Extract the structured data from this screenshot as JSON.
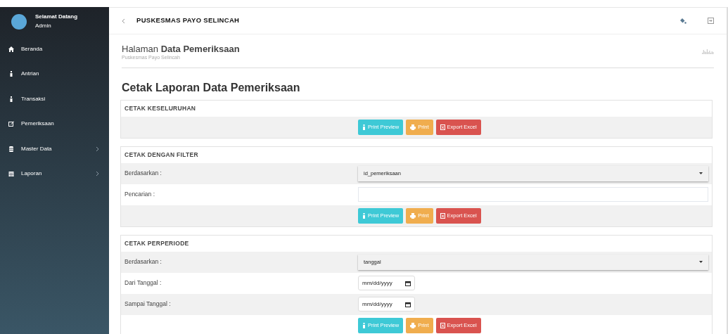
{
  "sidebar": {
    "greeting": "Selamat Datang",
    "user": "Admin",
    "items": [
      {
        "label": "Beranda",
        "kind": "home",
        "has_children": false
      },
      {
        "label": "Antrian",
        "kind": "info",
        "has_children": false
      },
      {
        "label": "Transaksi",
        "kind": "info",
        "has_children": false
      },
      {
        "label": "Pemeriksaan",
        "kind": "edit",
        "has_children": false
      },
      {
        "label": "Master Data",
        "kind": "database",
        "has_children": true
      },
      {
        "label": "Laporan",
        "kind": "calendar",
        "has_children": true
      }
    ]
  },
  "topbar": {
    "title": "PUSKESMAS PAYO SELINCAH"
  },
  "page_header": {
    "prefix": "Halaman",
    "title": "Data Pemeriksaan",
    "subtitle": "Puskesmas Payo Selincah"
  },
  "heading": "Cetak Laporan Data Pemeriksaan",
  "sections": [
    {
      "title": "CETAK KESELURUHAN",
      "rows": [
        {
          "kind": "buttons",
          "buttons": [
            {
              "label": "Print Preview",
              "kind": "preview"
            },
            {
              "label": "Print",
              "kind": "print"
            },
            {
              "label": "Export Excel",
              "kind": "excel"
            }
          ]
        }
      ]
    },
    {
      "title": "CETAK DENGAN FILTER",
      "rows": [
        {
          "kind": "select",
          "label": "Berdasarkan :",
          "value": "id_pemeriksaan"
        },
        {
          "kind": "text",
          "label": "Pencarian :"
        },
        {
          "kind": "buttons",
          "buttons": [
            {
              "label": "Print Preview",
              "kind": "preview"
            },
            {
              "label": "Print",
              "kind": "print"
            },
            {
              "label": "Export Excel",
              "kind": "excel"
            }
          ]
        }
      ]
    },
    {
      "title": "CETAK PERPERIODE",
      "rows": [
        {
          "kind": "select",
          "label": "Berdasarkan :",
          "value": "tanggal"
        },
        {
          "kind": "date",
          "label": "Dari Tanggal :",
          "placeholder": "mm/dd/yyyy"
        },
        {
          "kind": "date",
          "label": "Sampai Tanggal :",
          "placeholder": "mm/dd/yyyy"
        },
        {
          "kind": "buttons",
          "buttons": [
            {
              "label": "Print Preview",
              "kind": "preview"
            },
            {
              "label": "Print",
              "kind": "print"
            },
            {
              "label": "Export Excel",
              "kind": "excel"
            }
          ]
        }
      ]
    }
  ]
}
